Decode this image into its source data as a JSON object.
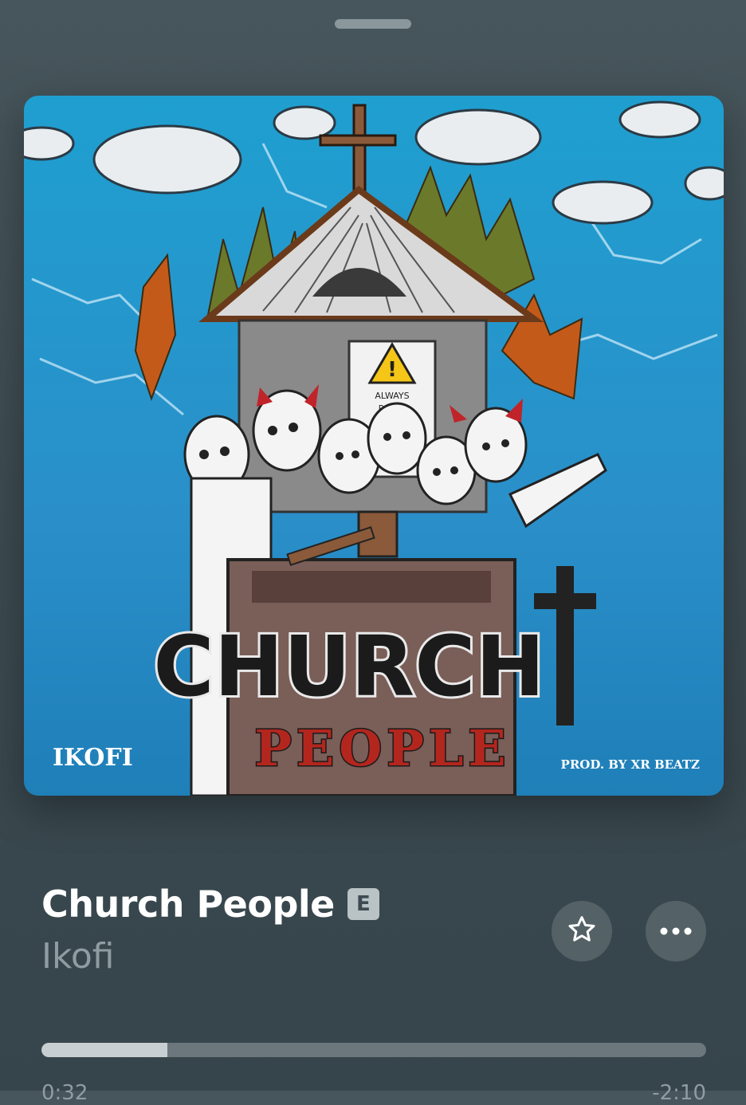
{
  "player": {
    "song_title": "Church People",
    "explicit_badge": "E",
    "artist": "Ikofi",
    "progress_fraction": 0.19,
    "time_elapsed": "0:32",
    "time_remaining": "-2:10"
  },
  "artwork": {
    "artist_text": "IKOFI",
    "producer_text": "PROD. BY XR BEATZ",
    "title_line1": "CHURCH",
    "title_line2": "PEOPLE",
    "sign_text_1": "ALWAYS",
    "sign_text_2": "RIGHT"
  },
  "icons": {
    "favorite": "star-icon",
    "more": "ellipsis-icon"
  },
  "colors": {
    "background": "#3d4b51",
    "title": "#ffffff",
    "secondary_text": "#8f9ca1",
    "progress_fill": "#c7cfd2",
    "progress_track": "#6b777c"
  }
}
